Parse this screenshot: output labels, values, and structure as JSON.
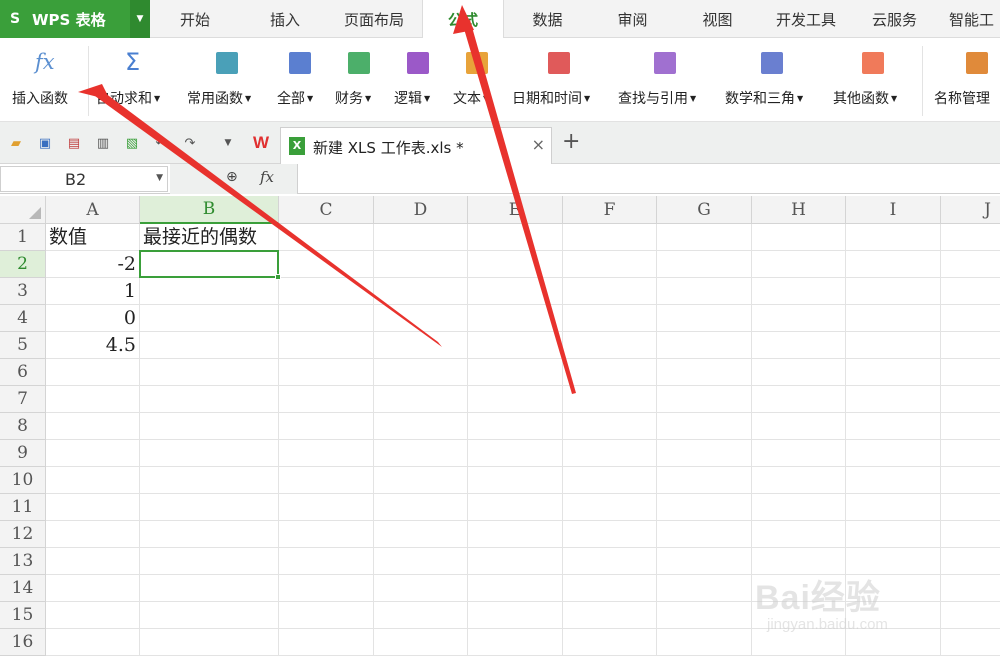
{
  "app": {
    "logo": "S",
    "name": "WPS 表格"
  },
  "tabs": [
    {
      "label": "开始"
    },
    {
      "label": "插入"
    },
    {
      "label": "页面布局"
    },
    {
      "label": "公式",
      "active": true
    },
    {
      "label": "数据"
    },
    {
      "label": "审阅"
    },
    {
      "label": "视图"
    },
    {
      "label": "开发工具"
    },
    {
      "label": "云服务"
    },
    {
      "label": "智能工"
    }
  ],
  "ribbon": [
    {
      "label": "插入函数",
      "icon": "fx-icon",
      "color": "#5b8fd0"
    },
    {
      "label": "自动求和",
      "icon": "sigma-icon",
      "color": "#4a7fd0"
    },
    {
      "label": "常用函数",
      "icon": "star-book-icon",
      "color": "#4aa0b8"
    },
    {
      "label": "全部",
      "icon": "list-book-icon",
      "color": "#5b7fd0"
    },
    {
      "label": "财务",
      "icon": "finance-book-icon",
      "color": "#4caf6a"
    },
    {
      "label": "逻辑",
      "icon": "question-book-icon",
      "color": "#9b59c8"
    },
    {
      "label": "文本",
      "icon": "text-book-icon",
      "color": "#e8a33a"
    },
    {
      "label": "日期和时间",
      "icon": "clock-book-icon",
      "color": "#e05a5a"
    },
    {
      "label": "查找与引用",
      "icon": "search-book-icon",
      "color": "#a070d0"
    },
    {
      "label": "数学和三角",
      "icon": "theta-book-icon",
      "color": "#6a7fd0"
    },
    {
      "label": "其他函数",
      "icon": "more-book-icon",
      "color": "#f07a5a"
    },
    {
      "label": "名称管理",
      "icon": "name-manager-icon",
      "color": "#e08a3a"
    }
  ],
  "document": {
    "tab_title": "新建 XLS 工作表.xls *",
    "close": "×",
    "add": "+"
  },
  "formula_bar": {
    "cell_ref": "B2",
    "fx": "fx",
    "value": ""
  },
  "columns": [
    "A",
    "B",
    "C",
    "D",
    "E",
    "F",
    "G",
    "H",
    "I",
    "J"
  ],
  "rows": [
    "1",
    "2",
    "3",
    "4",
    "5",
    "6",
    "7",
    "8",
    "9",
    "10",
    "11",
    "12",
    "13",
    "14",
    "15",
    "16"
  ],
  "cells": {
    "A1": "数值",
    "B1": "最接近的偶数",
    "A2": "-2",
    "A3": "1",
    "A4": "0",
    "A5": "4.5"
  },
  "watermark": {
    "main": "Bai经验",
    "sub": "jingyan.baidu.com"
  },
  "colors": {
    "accent": "#3a9f3a",
    "annotation_arrow": "#e8322d"
  }
}
